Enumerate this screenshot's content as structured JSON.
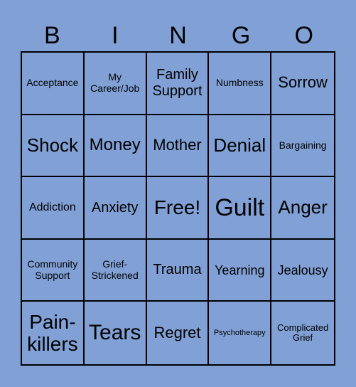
{
  "header": {
    "letters": [
      "B",
      "I",
      "N",
      "G",
      "O"
    ]
  },
  "colors": {
    "background": "#81a1d6",
    "grid_line": "#000000",
    "text": "#000000"
  },
  "board": {
    "rows": [
      [
        "Acceptance",
        "My Career/Job",
        "Family Support",
        "Numbness",
        "Sorrow"
      ],
      [
        "Shock",
        "Money",
        "Mother",
        "Denial",
        "Bargaining"
      ],
      [
        "Addiction",
        "Anxiety",
        "Free!",
        "Guilt",
        "Anger"
      ],
      [
        "Community Support",
        "Grief-Stricken­ed",
        "Trauma",
        "Yearning",
        "Jealousy"
      ],
      [
        "Pain-killers",
        "Tears",
        "Regret",
        "Psychotherapy",
        "Complicated Grief"
      ]
    ]
  }
}
